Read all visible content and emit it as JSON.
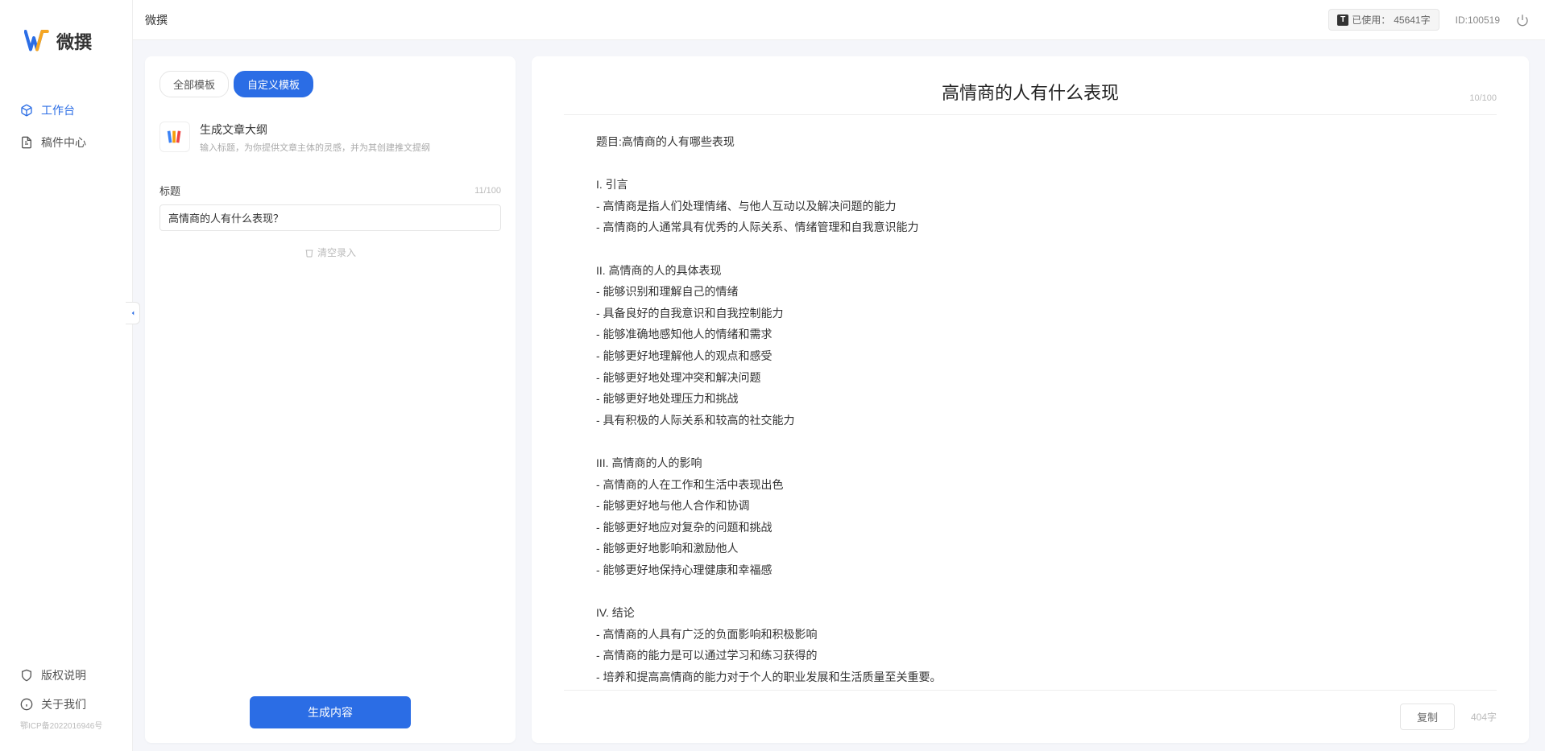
{
  "app": {
    "name": "微撰",
    "logo_text": "微撰"
  },
  "topbar": {
    "title": "微撰",
    "usage_label": "已使用：",
    "usage_value": "45641字",
    "id_prefix": "ID:",
    "id_value": "100519"
  },
  "sidebar": {
    "nav": [
      {
        "icon": "cube",
        "label": "工作台",
        "active": true
      },
      {
        "icon": "doc",
        "label": "稿件中心",
        "active": false
      }
    ],
    "bottom": [
      {
        "icon": "shield",
        "label": "版权说明"
      },
      {
        "icon": "info",
        "label": "关于我们"
      }
    ],
    "icp": "鄂ICP备2022016946号"
  },
  "left_panel": {
    "tabs": [
      {
        "label": "全部模板",
        "active": false
      },
      {
        "label": "自定义模板",
        "active": true
      }
    ],
    "template": {
      "title": "生成文章大纲",
      "desc": "输入标题，为你提供文章主体的灵感，并为其创建推文提纲"
    },
    "form": {
      "title_label": "标题",
      "title_count": "11/100",
      "title_value": "高情商的人有什么表现？",
      "clear_label": "清空录入"
    },
    "generate_btn": "生成内容"
  },
  "output": {
    "title": "高情商的人有什么表现",
    "title_count": "10/100",
    "body": "题目:高情商的人有哪些表现\n\nI. 引言\n- 高情商是指人们处理情绪、与他人互动以及解决问题的能力\n- 高情商的人通常具有优秀的人际关系、情绪管理和自我意识能力\n\nII. 高情商的人的具体表现\n- 能够识别和理解自己的情绪\n- 具备良好的自我意识和自我控制能力\n- 能够准确地感知他人的情绪和需求\n- 能够更好地理解他人的观点和感受\n- 能够更好地处理冲突和解决问题\n- 能够更好地处理压力和挑战\n- 具有积极的人际关系和较高的社交能力\n\nIII. 高情商的人的影响\n- 高情商的人在工作和生活中表现出色\n- 能够更好地与他人合作和协调\n- 能够更好地应对复杂的问题和挑战\n- 能够更好地影响和激励他人\n- 能够更好地保持心理健康和幸福感\n\nIV. 结论\n- 高情商的人具有广泛的负面影响和积极影响\n- 高情商的能力是可以通过学习和练习获得的\n- 培养和提高高情商的能力对于个人的职业发展和生活质量至关重要。",
    "copy_btn": "复制",
    "word_count": "404字"
  }
}
